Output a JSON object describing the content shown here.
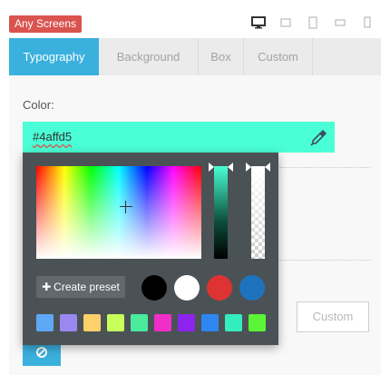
{
  "badge": {
    "label": "Any Screens",
    "color": "#d9534f"
  },
  "devices": [
    "desktop-icon",
    "laptop-icon",
    "tablet-icon",
    "tablet-landscape-icon",
    "phone-icon"
  ],
  "tabs": [
    {
      "label": "Typography",
      "active": true
    },
    {
      "label": "Background",
      "active": false
    },
    {
      "label": "Box",
      "active": false
    },
    {
      "label": "Custom",
      "active": false
    }
  ],
  "color_field": {
    "label": "Color:",
    "value": "#4affd5"
  },
  "picker": {
    "preset_button": "Create preset",
    "presets": [
      "#000000",
      "#ffffff",
      "#dd3333",
      "#1e73be"
    ],
    "swatches": [
      "#5fa8f5",
      "#9b88f0",
      "#fdd06a",
      "#c8ff5a",
      "#4aeb9c",
      "#f02ec8",
      "#8d23ee",
      "#2f86f1",
      "#33ecbf",
      "#5af536"
    ]
  },
  "custom_button": "Custom",
  "accent": "#3ab0dd"
}
